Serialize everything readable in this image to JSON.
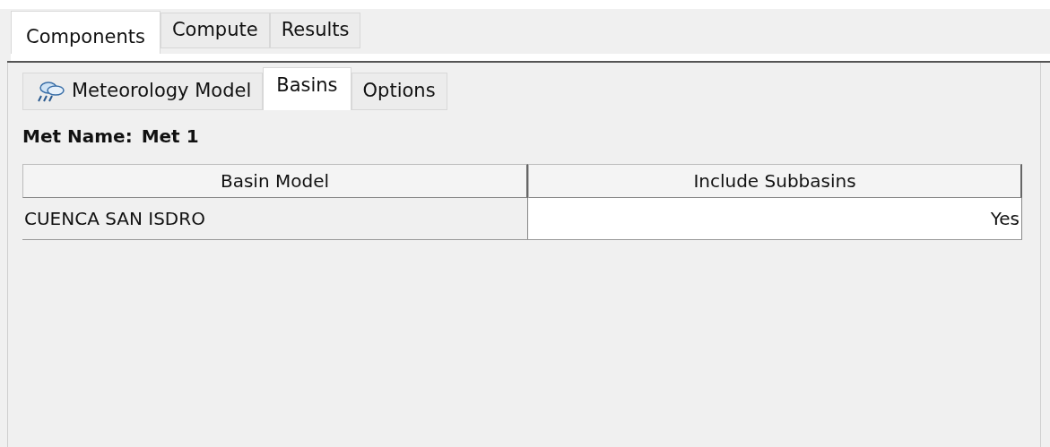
{
  "main_tabs": [
    {
      "label": "Components",
      "selected": true
    },
    {
      "label": "Compute",
      "selected": false
    },
    {
      "label": "Results",
      "selected": false
    }
  ],
  "sub_tabs": [
    {
      "label": "Meteorology Model",
      "selected": false,
      "kind": "icon"
    },
    {
      "label": "Basins",
      "selected": true,
      "kind": "plain"
    },
    {
      "label": "Options",
      "selected": false,
      "kind": "plain"
    }
  ],
  "met_name": {
    "label": "Met Name:",
    "value": "Met 1"
  },
  "table": {
    "columns": [
      "Basin Model",
      "Include Subbasins"
    ],
    "rows": [
      [
        "CUENCA SAN ISDRO",
        "Yes"
      ]
    ]
  }
}
